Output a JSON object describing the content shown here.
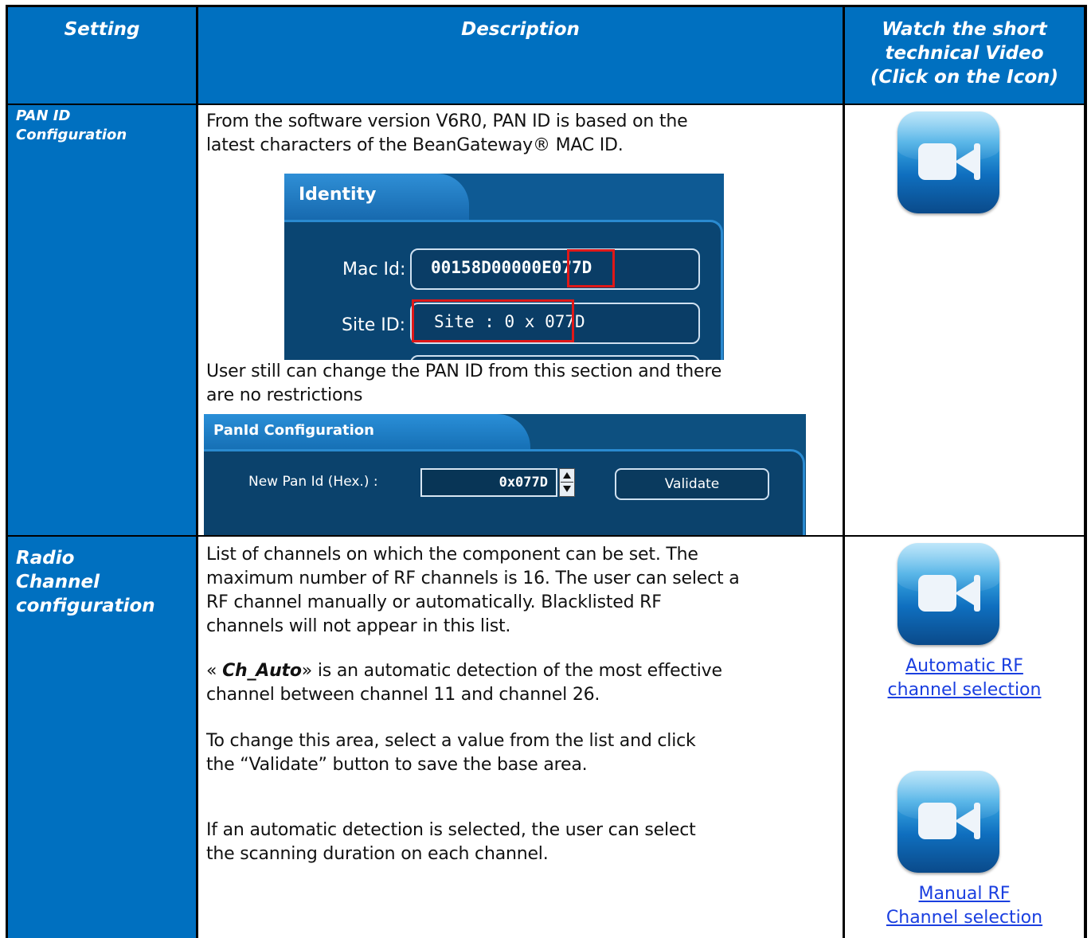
{
  "headers": {
    "setting": "Setting",
    "description": "Description",
    "video": [
      "Watch the short",
      "technical Video",
      "(Click on the Icon)"
    ]
  },
  "rows": [
    {
      "setting": [
        "PAN ID",
        "Configuration"
      ],
      "text1": [
        "From the software version V6R0, PAN ID is based on the",
        "latest characters of the BeanGateway® MAC ID."
      ],
      "identity": {
        "tab": "Identity",
        "mac_label": "Mac Id:",
        "mac_value": "00158D00000E077D",
        "site_label": "Site ID:",
        "site_value": "Site : 0 x 077D"
      },
      "text2": [
        "User still can change the PAN ID from this section and there",
        "are no restrictions"
      ],
      "panid": {
        "tab": "PanId Configuration",
        "label": "New Pan Id (Hex.) :",
        "value": "0x077D",
        "button": "Validate"
      }
    },
    {
      "setting": [
        "Radio",
        "Channel",
        "configuration"
      ],
      "p1": [
        "List of channels on which the component can be set. The",
        "maximum number of RF channels is 16. The user can select a",
        "RF channel manually or automatically. Blacklisted RF",
        "channels will not appear in this list."
      ],
      "p2_open": "« ",
      "p2_bold": "Ch_Auto",
      "p2_rest": "» is an automatic detection of the most effective",
      "p2_line2": "channel between channel 11 and channel 26.",
      "p3": [
        "To change this area, select a value from the list and click",
        "the “Validate” button to save the base area."
      ],
      "p4": [
        "If an automatic detection is selected, the user can select",
        "the scanning duration on each channel."
      ],
      "link1": [
        "Automatic RF",
        "channel selection"
      ],
      "link2": [
        "Manual RF",
        "Channel selection"
      ]
    }
  ]
}
